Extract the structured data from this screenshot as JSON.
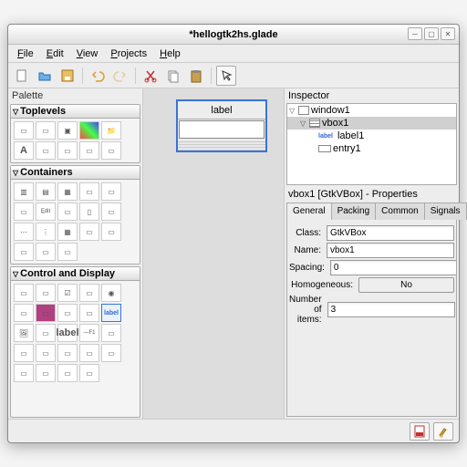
{
  "window": {
    "title": "*hellogtk2hs.glade"
  },
  "menu": {
    "file": "File",
    "edit": "Edit",
    "view": "View",
    "projects": "Projects",
    "help": "Help"
  },
  "palette": {
    "title": "Palette",
    "toplevels": "Toplevels",
    "containers": "Containers",
    "control": "Control and Display"
  },
  "design": {
    "label_text": "label"
  },
  "inspector": {
    "title": "Inspector",
    "window1": "window1",
    "vbox1": "vbox1",
    "label1": "label1",
    "entry1": "entry1"
  },
  "properties": {
    "title": "vbox1 [GtkVBox] - Properties",
    "tab_general": "General",
    "tab_packing": "Packing",
    "tab_common": "Common",
    "tab_signals": "Signals",
    "class_label": "Class:",
    "class_value": "GtkVBox",
    "name_label": "Name:",
    "name_value": "vbox1",
    "spacing_label": "Spacing:",
    "spacing_value": "0",
    "homo_label": "Homogeneous:",
    "homo_value": "No",
    "nitems_label": "Number of items:",
    "nitems_value": "3"
  }
}
